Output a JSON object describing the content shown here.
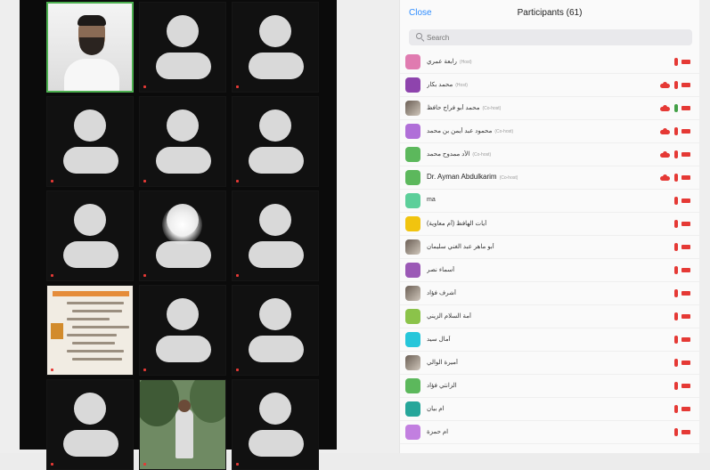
{
  "panel": {
    "close_label": "Close",
    "title": "Participants (61)",
    "search_placeholder": "Search"
  },
  "colors": {
    "accent": "#2d8cff",
    "mic_muted": "#e53935",
    "mic_active": "#43a047",
    "active_speaker": "#4caf50"
  },
  "grid_tiles": [
    {
      "kind": "person",
      "label": "",
      "active": true
    },
    {
      "kind": "avatar",
      "label": ""
    },
    {
      "kind": "avatar",
      "label": ""
    },
    {
      "kind": "avatar",
      "label": ""
    },
    {
      "kind": "avatar",
      "label": ""
    },
    {
      "kind": "avatar",
      "label": ""
    },
    {
      "kind": "avatar",
      "label": ""
    },
    {
      "kind": "glare",
      "label": ""
    },
    {
      "kind": "avatar",
      "label": ""
    },
    {
      "kind": "doc",
      "label": ""
    },
    {
      "kind": "avatar",
      "label": ""
    },
    {
      "kind": "avatar",
      "label": ""
    },
    {
      "kind": "avatar",
      "label": ""
    },
    {
      "kind": "outdoor",
      "label": ""
    },
    {
      "kind": "avatar",
      "label": ""
    }
  ],
  "participants": [
    {
      "name": "رابعة عمري",
      "suffix": "(Host)",
      "avatar_color": "#e07bb0",
      "mic": "muted",
      "cloud": false
    },
    {
      "name": "محمد بكار",
      "suffix": "(Host)",
      "avatar_color": "#8e44ad",
      "mic": "muted",
      "cloud": true
    },
    {
      "name": "محمد أبو فراج حافظ",
      "suffix": "(Co-host)",
      "avatar_photo": true,
      "mic": "active",
      "cloud": true
    },
    {
      "name": "محمود عبد أيمن بن محمد",
      "suffix": "(Co-host)",
      "avatar_color": "#b06fd8",
      "mic": "muted",
      "cloud": true
    },
    {
      "name": "الأد ممدوح محمد",
      "suffix": "(Co-host)",
      "avatar_color": "#5cb85c",
      "mic": "muted",
      "cloud": true
    },
    {
      "name": "Dr. Ayman Abdulkarim",
      "suffix": "(Co-host)",
      "avatar_color": "#5cb85c",
      "mic": "muted",
      "cloud": true,
      "strong": true
    },
    {
      "name": "ma",
      "suffix": "",
      "avatar_color": "#5ccf9a",
      "mic": "muted",
      "cloud": false
    },
    {
      "name": "آيات الهافظ (أم معاوية)",
      "suffix": "",
      "avatar_color": "#f1c40f",
      "mic": "muted",
      "cloud": false
    },
    {
      "name": "أبو ماهر عبد الغني سليمان",
      "suffix": "",
      "avatar_photo": true,
      "mic": "muted",
      "cloud": false
    },
    {
      "name": "أسماء نصر",
      "suffix": "",
      "avatar_color": "#9b59b6",
      "mic": "muted",
      "cloud": false
    },
    {
      "name": "أشرف فؤاد",
      "suffix": "",
      "avatar_photo": true,
      "mic": "muted",
      "cloud": false
    },
    {
      "name": "أمة السلام الزيني",
      "suffix": "",
      "avatar_color": "#8bc34a",
      "mic": "muted",
      "cloud": false
    },
    {
      "name": "آمال سيد",
      "suffix": "",
      "avatar_color": "#26c6da",
      "mic": "muted",
      "cloud": false
    },
    {
      "name": "أميرة الوالي",
      "suffix": "",
      "avatar_photo": true,
      "mic": "muted",
      "cloud": false
    },
    {
      "name": "الزانتي فؤاد",
      "suffix": "",
      "avatar_color": "#5cb85c",
      "mic": "muted",
      "cloud": false
    },
    {
      "name": "ام بيان",
      "suffix": "",
      "avatar_color": "#26a69a",
      "mic": "muted",
      "cloud": false
    },
    {
      "name": "ام حمزة",
      "suffix": "",
      "avatar_color": "#c27fe0",
      "mic": "muted",
      "cloud": false
    }
  ]
}
